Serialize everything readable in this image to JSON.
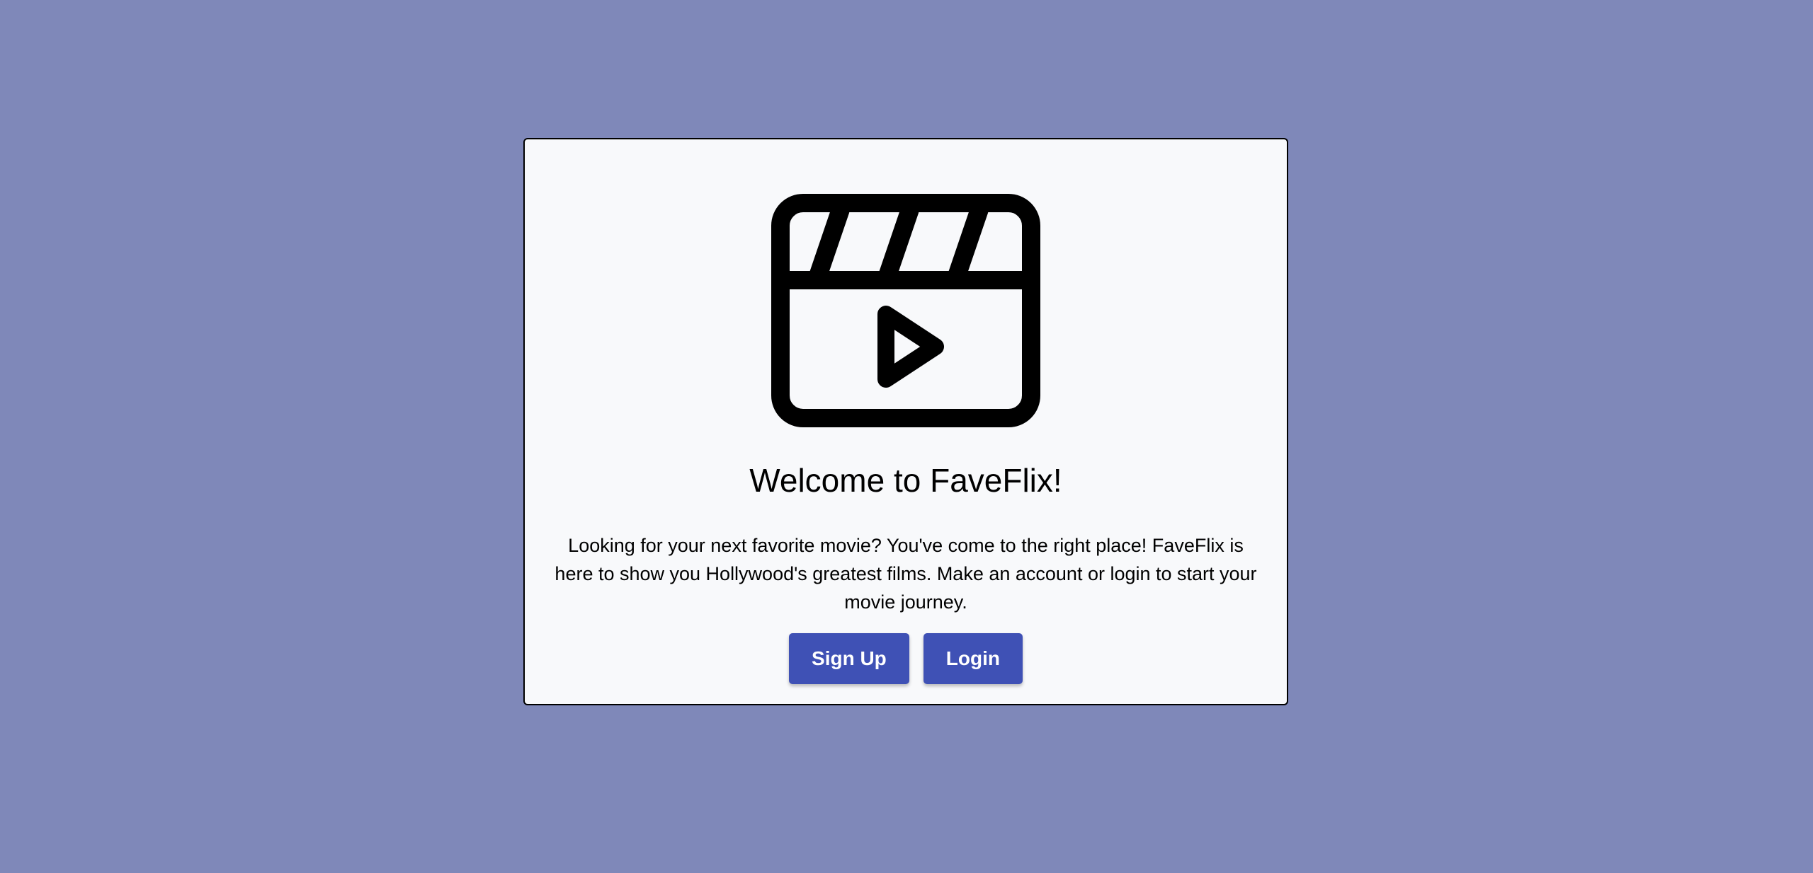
{
  "welcome": {
    "logo_icon": "movie-clapperboard-play-icon",
    "title": "Welcome to FaveFlix!",
    "description": "Looking for your next favorite movie? You've come to the right place! FaveFlix is here to show you Hollywood's greatest films. Make an account or login to start your movie journey.",
    "signup_label": "Sign Up",
    "login_label": "Login"
  },
  "colors": {
    "background": "#7f88b9",
    "card": "#f8f9fb",
    "accent": "#3f51b5"
  }
}
